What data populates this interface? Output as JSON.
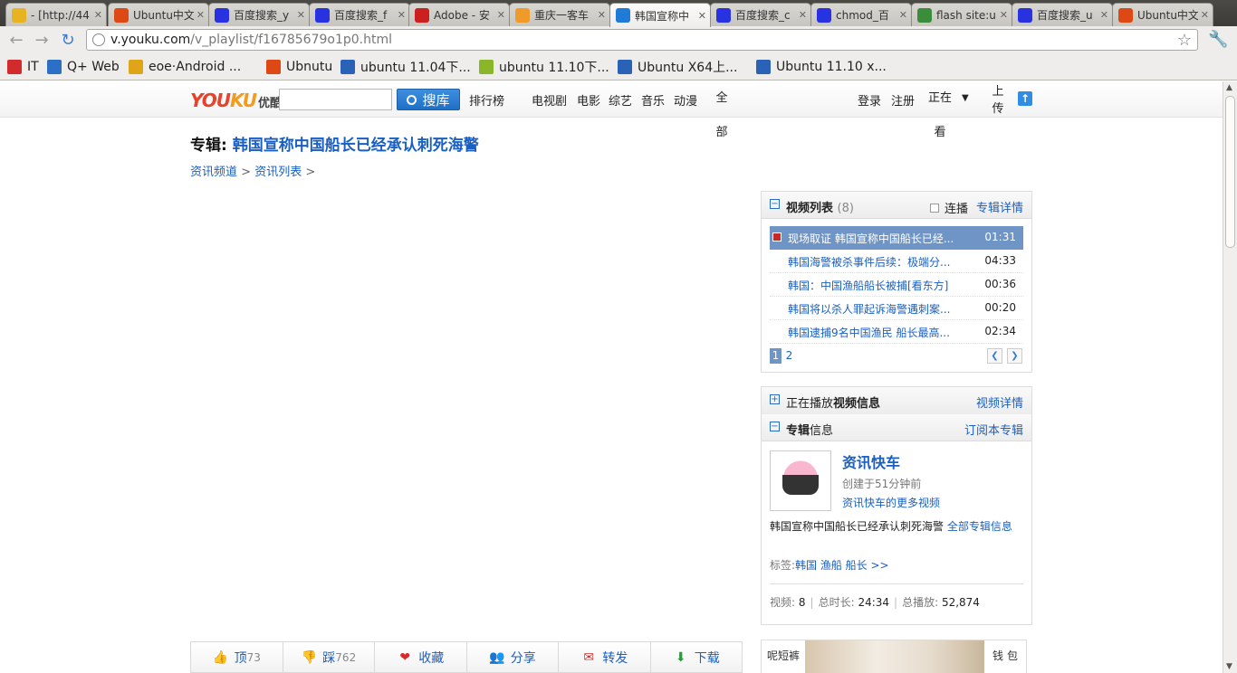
{
  "browser": {
    "tabs": [
      {
        "title": "- [http://44",
        "icon": "star-icon",
        "color": "#e8b320"
      },
      {
        "title": "Ubuntu中文",
        "icon": "ubuntu-icon",
        "color": "#dd4814"
      },
      {
        "title": "百度搜索_y",
        "icon": "baidu-icon",
        "color": "#2932e1"
      },
      {
        "title": "百度搜索_f",
        "icon": "baidu-icon",
        "color": "#2932e1"
      },
      {
        "title": "Adobe - 安",
        "icon": "adobe-icon",
        "color": "#cc1f1f"
      },
      {
        "title": "重庆一客车",
        "icon": "cq-icon",
        "color": "#f09a2a"
      },
      {
        "title": "韩国宣称中",
        "icon": "youku-icon",
        "color": "#1f7ad8"
      },
      {
        "title": "百度搜索_c",
        "icon": "baidu-icon",
        "color": "#2932e1"
      },
      {
        "title": "chmod_百",
        "icon": "baidu-icon",
        "color": "#2932e1"
      },
      {
        "title": "flash site:u",
        "icon": "google-icon",
        "color": "#3b8d3b"
      },
      {
        "title": "百度搜索_u",
        "icon": "baidu-icon",
        "color": "#2932e1"
      },
      {
        "title": "Ubuntu中文",
        "icon": "ubuntu-icon",
        "color": "#dd4814"
      }
    ],
    "url_host": "v.youku.com",
    "url_path": "/v_playlist/f16785679o1p0.html",
    "bookmarks": [
      {
        "label": "IT",
        "icon": "it-icon",
        "color": "#d22b2b"
      },
      {
        "label": "Q+ Web",
        "icon": "qplus-icon",
        "color": "#2b6fc7"
      },
      {
        "label": "eoe·Android ...",
        "icon": "eoe-icon",
        "color": "#e0a418"
      },
      {
        "label": "Ubnutu",
        "icon": "ubuntu-icon",
        "color": "#dd4814"
      },
      {
        "label": "ubuntu 11.04下...",
        "icon": "cnblogs-icon",
        "color": "#2a62b8"
      },
      {
        "label": "ubuntu 11.10下...",
        "icon": "android-icon",
        "color": "#8ab72a"
      },
      {
        "label": "Ubuntu X64上...",
        "icon": "cnblogs-icon",
        "color": "#2a62b8"
      },
      {
        "label": "Ubuntu 11.10 x...",
        "icon": "cnblogs-icon",
        "color": "#2a62b8"
      }
    ]
  },
  "youku": {
    "logo_a": "YOU",
    "logo_b": "KU",
    "logo_cn": "优酷",
    "search_button": "搜库",
    "search_value": "",
    "nav": [
      "排行榜",
      "电视剧",
      "电影",
      "综艺",
      "音乐",
      "动漫"
    ],
    "nav_all": [
      "全",
      "部"
    ],
    "login": "登录",
    "register": "注册",
    "watching": [
      "正在",
      "看"
    ],
    "upload": [
      "上",
      "传"
    ],
    "album_prefix": "专辑:",
    "album_title": "韩国宣称中国船长已经承认刺死海警",
    "breadcrumb": [
      "资讯频道",
      "资讯列表"
    ],
    "actions": [
      {
        "label": "顶",
        "count": "73",
        "icon": "thumbs-up-icon",
        "glyph": "👍"
      },
      {
        "label": "踩",
        "count": "762",
        "icon": "thumbs-down-icon",
        "glyph": "👎"
      },
      {
        "label": "收藏",
        "count": "",
        "icon": "heart-icon",
        "glyph": "❤"
      },
      {
        "label": "分享",
        "count": "",
        "icon": "share-icon",
        "glyph": "👥"
      },
      {
        "label": "转发",
        "count": "",
        "icon": "forward-icon",
        "glyph": "✉"
      },
      {
        "label": "下载",
        "count": "",
        "icon": "download-icon",
        "glyph": "⬇"
      }
    ],
    "videolist": {
      "title": "视频列表",
      "count": "(8)",
      "continuous": "连播",
      "detail_link": "专辑详情",
      "items": [
        {
          "title": "现场取证 韩国宣称中国船长已经...",
          "duration": "01:31",
          "active": true
        },
        {
          "title": "韩国海警被杀事件后续：极端分...",
          "duration": "04:33",
          "active": false
        },
        {
          "title": "韩国：中国渔船船长被捕[看东方]",
          "duration": "00:36",
          "active": false
        },
        {
          "title": "韩国将以杀人罪起诉海警遇刺案...",
          "duration": "00:20",
          "active": false
        },
        {
          "title": "韩国逮捕9名中国渔民 船长最高...",
          "duration": "02:34",
          "active": false
        }
      ],
      "pages": [
        "1",
        "2"
      ]
    },
    "nowplaying": {
      "title_a": "正在播放",
      "title_b": "视频信息",
      "link": "视频详情"
    },
    "albuminfo": {
      "title_a": "专辑",
      "title_b": "信息",
      "subscribe": "订阅本专辑",
      "user": "资讯快车",
      "created": "创建于51分钟前",
      "more": "资讯快车的更多视频",
      "desc": "韩国宣称中国船长已经承认刺死海警",
      "desc_link": "全部专辑信息",
      "tags_label": "标签:",
      "tags": "韩国 渔船 船长 >>",
      "videos_label": "视频:",
      "videos": "8",
      "duration_label": "总时长:",
      "duration": "24:34",
      "plays_label": "总播放:",
      "plays": "52,874"
    },
    "ad": {
      "left": "呢短裤",
      "right": "钱包"
    }
  }
}
